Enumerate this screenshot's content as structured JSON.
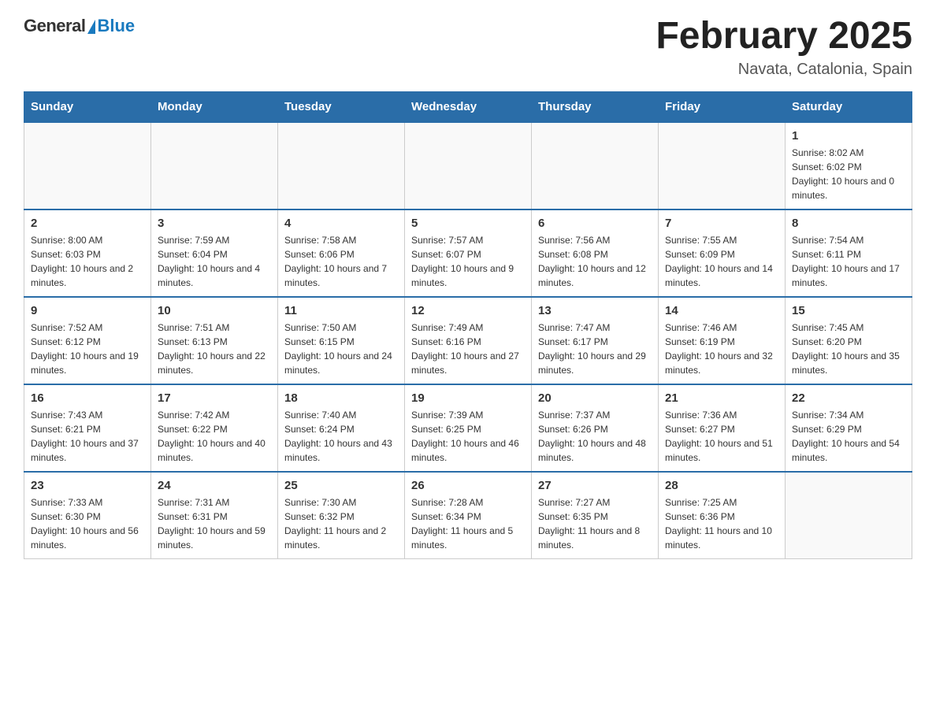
{
  "logo": {
    "general": "General",
    "blue": "Blue"
  },
  "header": {
    "title": "February 2025",
    "subtitle": "Navata, Catalonia, Spain"
  },
  "weekdays": [
    "Sunday",
    "Monday",
    "Tuesday",
    "Wednesday",
    "Thursday",
    "Friday",
    "Saturday"
  ],
  "weeks": [
    [
      {
        "day": "",
        "info": ""
      },
      {
        "day": "",
        "info": ""
      },
      {
        "day": "",
        "info": ""
      },
      {
        "day": "",
        "info": ""
      },
      {
        "day": "",
        "info": ""
      },
      {
        "day": "",
        "info": ""
      },
      {
        "day": "1",
        "info": "Sunrise: 8:02 AM\nSunset: 6:02 PM\nDaylight: 10 hours and 0 minutes."
      }
    ],
    [
      {
        "day": "2",
        "info": "Sunrise: 8:00 AM\nSunset: 6:03 PM\nDaylight: 10 hours and 2 minutes."
      },
      {
        "day": "3",
        "info": "Sunrise: 7:59 AM\nSunset: 6:04 PM\nDaylight: 10 hours and 4 minutes."
      },
      {
        "day": "4",
        "info": "Sunrise: 7:58 AM\nSunset: 6:06 PM\nDaylight: 10 hours and 7 minutes."
      },
      {
        "day": "5",
        "info": "Sunrise: 7:57 AM\nSunset: 6:07 PM\nDaylight: 10 hours and 9 minutes."
      },
      {
        "day": "6",
        "info": "Sunrise: 7:56 AM\nSunset: 6:08 PM\nDaylight: 10 hours and 12 minutes."
      },
      {
        "day": "7",
        "info": "Sunrise: 7:55 AM\nSunset: 6:09 PM\nDaylight: 10 hours and 14 minutes."
      },
      {
        "day": "8",
        "info": "Sunrise: 7:54 AM\nSunset: 6:11 PM\nDaylight: 10 hours and 17 minutes."
      }
    ],
    [
      {
        "day": "9",
        "info": "Sunrise: 7:52 AM\nSunset: 6:12 PM\nDaylight: 10 hours and 19 minutes."
      },
      {
        "day": "10",
        "info": "Sunrise: 7:51 AM\nSunset: 6:13 PM\nDaylight: 10 hours and 22 minutes."
      },
      {
        "day": "11",
        "info": "Sunrise: 7:50 AM\nSunset: 6:15 PM\nDaylight: 10 hours and 24 minutes."
      },
      {
        "day": "12",
        "info": "Sunrise: 7:49 AM\nSunset: 6:16 PM\nDaylight: 10 hours and 27 minutes."
      },
      {
        "day": "13",
        "info": "Sunrise: 7:47 AM\nSunset: 6:17 PM\nDaylight: 10 hours and 29 minutes."
      },
      {
        "day": "14",
        "info": "Sunrise: 7:46 AM\nSunset: 6:19 PM\nDaylight: 10 hours and 32 minutes."
      },
      {
        "day": "15",
        "info": "Sunrise: 7:45 AM\nSunset: 6:20 PM\nDaylight: 10 hours and 35 minutes."
      }
    ],
    [
      {
        "day": "16",
        "info": "Sunrise: 7:43 AM\nSunset: 6:21 PM\nDaylight: 10 hours and 37 minutes."
      },
      {
        "day": "17",
        "info": "Sunrise: 7:42 AM\nSunset: 6:22 PM\nDaylight: 10 hours and 40 minutes."
      },
      {
        "day": "18",
        "info": "Sunrise: 7:40 AM\nSunset: 6:24 PM\nDaylight: 10 hours and 43 minutes."
      },
      {
        "day": "19",
        "info": "Sunrise: 7:39 AM\nSunset: 6:25 PM\nDaylight: 10 hours and 46 minutes."
      },
      {
        "day": "20",
        "info": "Sunrise: 7:37 AM\nSunset: 6:26 PM\nDaylight: 10 hours and 48 minutes."
      },
      {
        "day": "21",
        "info": "Sunrise: 7:36 AM\nSunset: 6:27 PM\nDaylight: 10 hours and 51 minutes."
      },
      {
        "day": "22",
        "info": "Sunrise: 7:34 AM\nSunset: 6:29 PM\nDaylight: 10 hours and 54 minutes."
      }
    ],
    [
      {
        "day": "23",
        "info": "Sunrise: 7:33 AM\nSunset: 6:30 PM\nDaylight: 10 hours and 56 minutes."
      },
      {
        "day": "24",
        "info": "Sunrise: 7:31 AM\nSunset: 6:31 PM\nDaylight: 10 hours and 59 minutes."
      },
      {
        "day": "25",
        "info": "Sunrise: 7:30 AM\nSunset: 6:32 PM\nDaylight: 11 hours and 2 minutes."
      },
      {
        "day": "26",
        "info": "Sunrise: 7:28 AM\nSunset: 6:34 PM\nDaylight: 11 hours and 5 minutes."
      },
      {
        "day": "27",
        "info": "Sunrise: 7:27 AM\nSunset: 6:35 PM\nDaylight: 11 hours and 8 minutes."
      },
      {
        "day": "28",
        "info": "Sunrise: 7:25 AM\nSunset: 6:36 PM\nDaylight: 11 hours and 10 minutes."
      },
      {
        "day": "",
        "info": ""
      }
    ]
  ]
}
